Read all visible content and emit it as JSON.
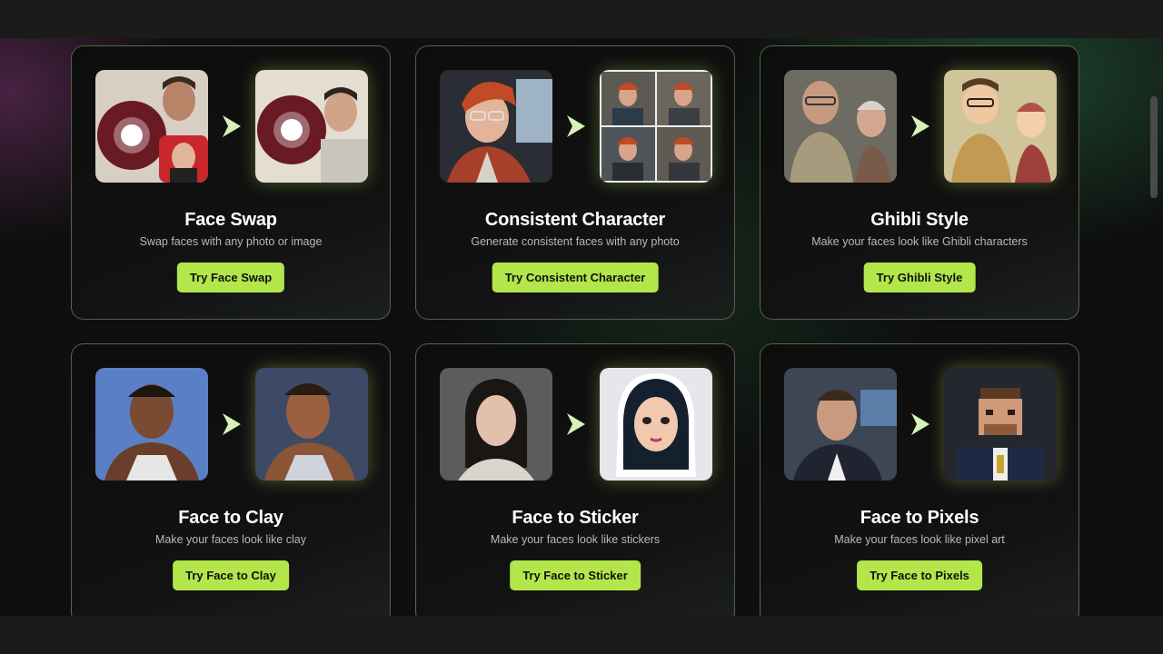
{
  "cards": [
    {
      "title": "Face Swap",
      "subtitle": "Swap faces with any photo or image",
      "button": "Try Face Swap"
    },
    {
      "title": "Consistent Character",
      "subtitle": "Generate consistent faces with any photo",
      "button": "Try Consistent Character"
    },
    {
      "title": "Ghibli Style",
      "subtitle": "Make your faces look like Ghibli characters",
      "button": "Try Ghibli Style"
    },
    {
      "title": "Face to Clay",
      "subtitle": "Make your faces look like clay",
      "button": "Try Face to Clay"
    },
    {
      "title": "Face to Sticker",
      "subtitle": "Make your faces look like stickers",
      "button": "Try Face to Sticker"
    },
    {
      "title": "Face to Pixels",
      "subtitle": "Make your faces look like pixel art",
      "button": "Try Face to Pixels"
    }
  ],
  "icons": {
    "arrow": "arrow-right-icon"
  },
  "colors": {
    "accent": "#b2e64a",
    "background": "#0e0f0e",
    "card_border": "#8fbf70"
  }
}
